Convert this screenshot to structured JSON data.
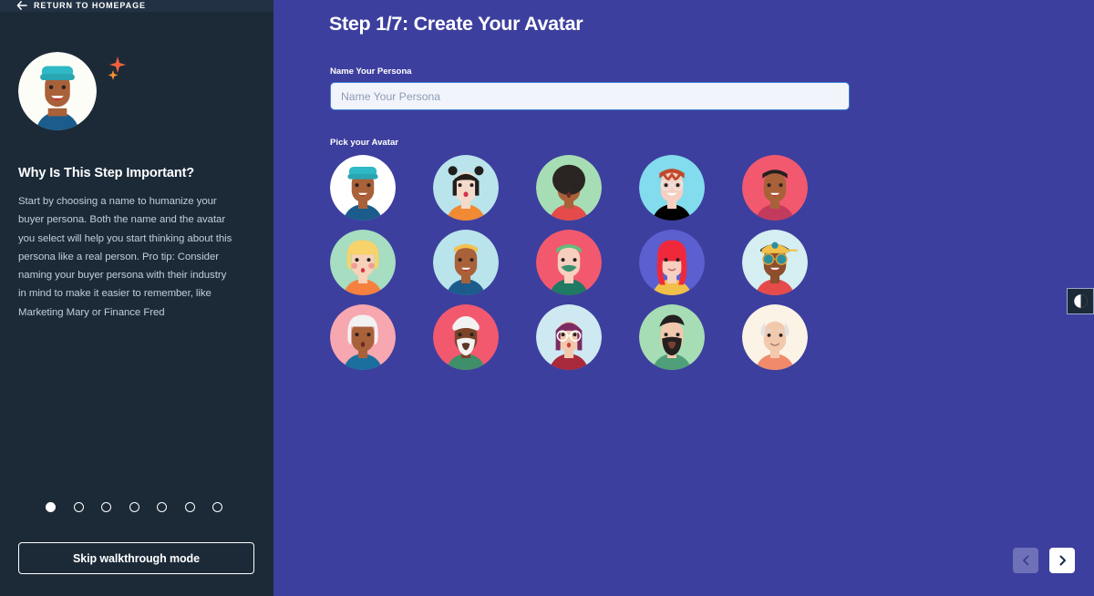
{
  "colors": {
    "sidebar_bg": "#1c2a38",
    "main_bg": "#3d3f9e",
    "topbar_bg": "#223244",
    "input_bg": "#f2f4fb",
    "input_border": "#3f7fd4",
    "accent_white": "#ffffff",
    "body_text": "#c3cdd7",
    "nav_prev_bg": "#6f71b8",
    "nav_next_bg": "#ffffff"
  },
  "sidebar": {
    "return_link": "RETURN TO HOMEPAGE",
    "return_icon": "arrow-left-icon",
    "avatar_icon": "persona-avatar-beanie-icon",
    "sparkles_icon": "sparkles-icon",
    "heading": "Why Is This Step Important?",
    "body": "Start by choosing a name to humanize your buyer persona. Both the name and the avatar you select will help you start thinking about this persona like a real person. Pro tip: Consider naming your buyer persona with their industry in mind to make it easier to remember, like Marketing Mary or Finance Fred",
    "skip_button": "Skip walkthrough mode",
    "step_dots": {
      "total": 7,
      "active_index": 0
    }
  },
  "main": {
    "step_title": "Step 1/7: Create Your Avatar",
    "name_field": {
      "label": "Name Your Persona",
      "placeholder": "Name Your Persona",
      "value": ""
    },
    "avatar_section_label": "Pick your Avatar",
    "avatars": [
      {
        "id": "avatar-1",
        "name": "man-teal-beanie",
        "bg": "#ffffff",
        "skin": "#a9613a",
        "hair": "#2f2b29",
        "accent": "#1f6f8f",
        "top": "#1b5c8c"
      },
      {
        "id": "avatar-2",
        "name": "girl-black-buns",
        "bg": "#b9e4ec",
        "skin": "#f3dacb",
        "hair": "#211d1c",
        "accent": "#211d1c",
        "top": "#f08a34"
      },
      {
        "id": "avatar-3",
        "name": "woman-afro-green-bg",
        "bg": "#a7ddb4",
        "skin": "#a9613a",
        "hair": "#2a2522",
        "accent": "#2a2522",
        "top": "#e54b4b"
      },
      {
        "id": "avatar-4",
        "name": "man-red-hair-glasses",
        "bg": "#82dced",
        "skin": "#f6cfc0",
        "hair": "#c0492c",
        "accent": "#ffffff",
        "top": "#f5c councils"
      },
      {
        "id": "avatar-5",
        "name": "man-dark-hair-pink-bg",
        "bg": "#f2596f",
        "skin": "#a9613a",
        "hair": "#24201f",
        "accent": "#24201f",
        "top": "#c23a5c"
      },
      {
        "id": "avatar-6",
        "name": "woman-blonde-curly",
        "bg": "#a7ddc0",
        "skin": "#f6d2b8",
        "hair": "#f8d26a",
        "accent": "#f08a8a",
        "top": "#f5803f"
      },
      {
        "id": "avatar-7",
        "name": "man-blonde-short",
        "bg": "#b9e4ec",
        "skin": "#a9613a",
        "hair": "#f2c14e",
        "accent": "#2a2522",
        "top": "#1b5c8c"
      },
      {
        "id": "avatar-8",
        "name": "man-green-hair-mustache",
        "bg": "#f2596f",
        "skin": "#f6cfc0",
        "hair": "#5fbf7a",
        "accent": "#3a8f6f",
        "top": "#1f7a63"
      },
      {
        "id": "avatar-9",
        "name": "woman-red-long-hair",
        "bg": "#5b5fd0",
        "skin": "#f6cfc0",
        "hair": "#f0283c",
        "accent": "#f0283c",
        "top": "#f0c04a"
      },
      {
        "id": "avatar-10",
        "name": "man-cap-sunglasses",
        "bg": "#d5eef2",
        "skin": "#8b4f2e",
        "hair": "#2a2522",
        "accent": "#2b8f9e",
        "top": "#e54b4b"
      },
      {
        "id": "avatar-11",
        "name": "woman-white-hair",
        "bg": "#f6a7b0",
        "skin": "#a9613a",
        "hair": "#f2f2f2",
        "accent": "#f2f2f2",
        "top": "#1b6f9e"
      },
      {
        "id": "avatar-12",
        "name": "elder-man-white-beard",
        "bg": "#f2596f",
        "skin": "#7b4428",
        "hair": "#f2f2f2",
        "accent": "#f2f2f2",
        "top": "#3f8f6a"
      },
      {
        "id": "avatar-13",
        "name": "woman-purple-bob-glasses",
        "bg": "#cfe9f2",
        "skin": "#f3c9ae",
        "hair": "#7d2a63",
        "accent": "#ffffff",
        "top": "#a82a3c"
      },
      {
        "id": "avatar-14",
        "name": "man-black-beard-pompadour",
        "bg": "#a7ddb4",
        "skin": "#f3c9ae",
        "hair": "#24201f",
        "accent": "#24201f",
        "top": "#4f9f7a"
      },
      {
        "id": "avatar-15",
        "name": "bald-elder-man",
        "bg": "#fbf3e6",
        "skin": "#f3c9ae",
        "hair": "#e2e2e2",
        "accent": "#e2e2e2",
        "top": "#f08a6a"
      }
    ],
    "nav": {
      "prev_icon": "chevron-left-icon",
      "next_icon": "chevron-right-icon",
      "prev_enabled": false,
      "next_enabled": true
    }
  },
  "contrast_widget": {
    "icon": "contrast-toggle-icon",
    "label": "Toggle contrast"
  }
}
